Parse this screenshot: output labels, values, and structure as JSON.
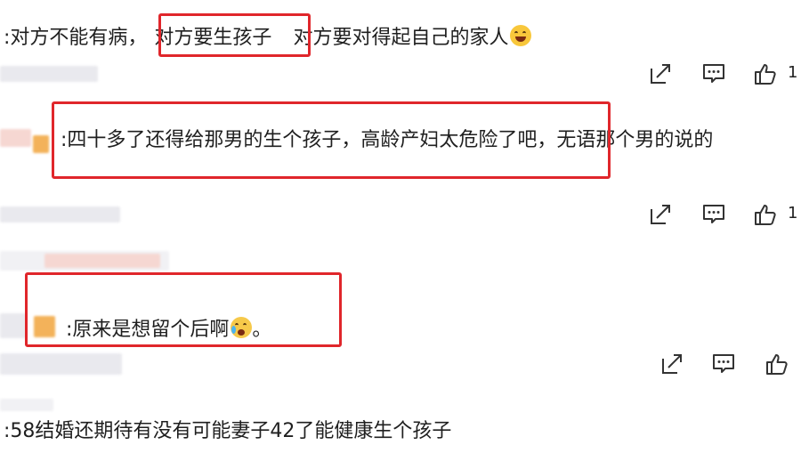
{
  "comments": [
    {
      "text_before": ":对方不能有病，",
      "highlight": "对方要生孩子",
      "text_after": "对方要对得起自己的家人",
      "emoji": "laughing-emoji",
      "like_count": "1"
    },
    {
      "text": ":四十多了还得给那男的生个孩子，高龄产妇太危险了吧，无语那个男的说的",
      "like_count": "1"
    },
    {
      "text": ":原来是想留个后啊",
      "emoji": "crying-emoji",
      "text_end": "。"
    },
    {
      "text": ":58结婚还期待有没有可能妻子42了能健康生个孩子"
    }
  ],
  "icons": {
    "share": "share-icon",
    "comment": "comment-icon",
    "like": "thumbs-up-icon"
  },
  "colors": {
    "highlight_border": "#e0262b",
    "text": "#1f1f1f",
    "icon": "#333333"
  }
}
